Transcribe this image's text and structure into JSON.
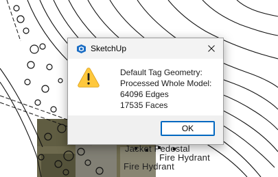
{
  "background": {
    "labels": [
      "Jacket Pedestal",
      "Fire Hydrant",
      "Fire Hydrant"
    ]
  },
  "dialog": {
    "title": "SketchUp",
    "app_icon": "sketchup-icon",
    "close_icon": "close-icon",
    "status_icon": "warning-icon",
    "message_lines": [
      "Default Tag Geometry:",
      "Processed Whole Model:",
      "64096 Edges",
      "17535 Faces"
    ],
    "ok_label": "OK"
  },
  "colors": {
    "accent": "#0067c0",
    "warning": "#ffc83d",
    "titlebar": "#f3f3f3",
    "footer": "#f0f0f0"
  }
}
